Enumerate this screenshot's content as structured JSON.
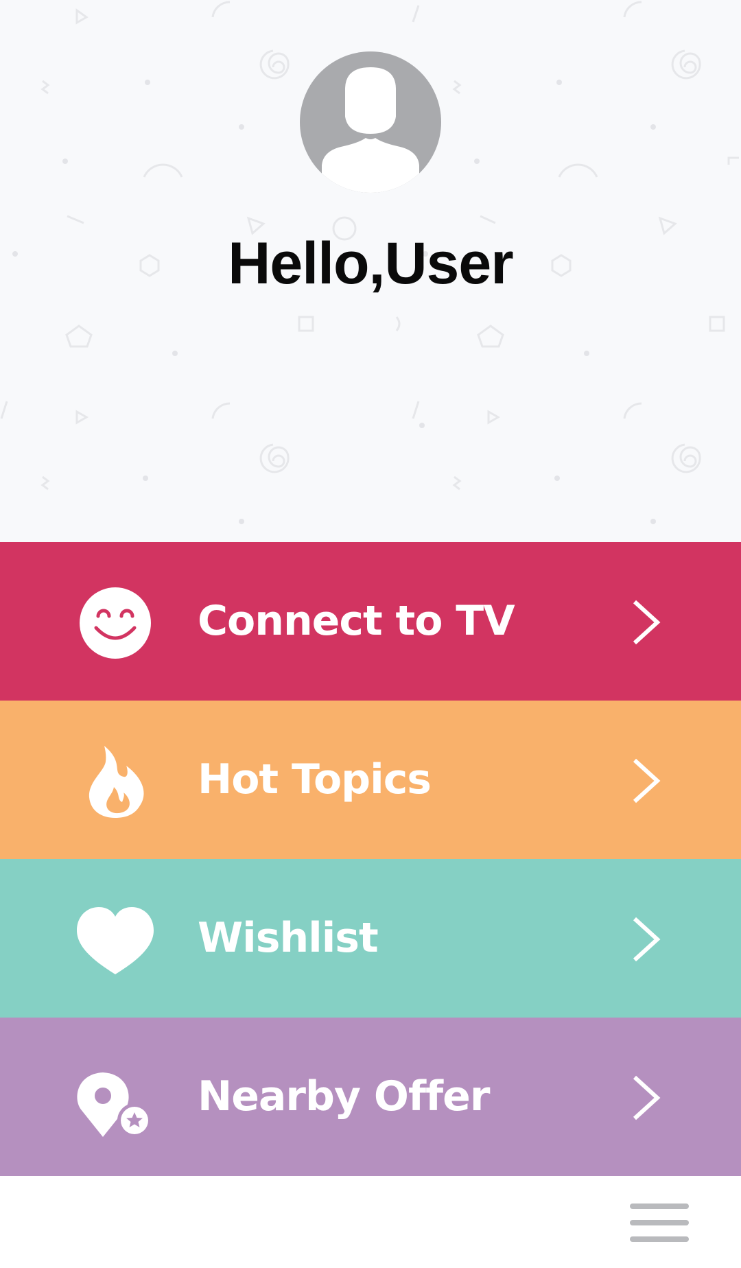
{
  "profile": {
    "greeting": "Hello,User",
    "avatar_icon": "user-silhouette-icon",
    "avatar_color": "#a9aaad"
  },
  "menu": {
    "items": [
      {
        "label": "Connect to TV",
        "icon": "smiley-face-icon",
        "color": "#d23461"
      },
      {
        "label": "Hot Topics",
        "icon": "flame-icon",
        "color": "#f9b16b"
      },
      {
        "label": "Wishlist",
        "icon": "heart-icon",
        "color": "#85d0c4"
      },
      {
        "label": "Nearby Offer",
        "icon": "location-star-icon",
        "color": "#b590bf"
      }
    ]
  },
  "bottom_bar": {
    "menu_icon": "hamburger-menu-icon"
  }
}
